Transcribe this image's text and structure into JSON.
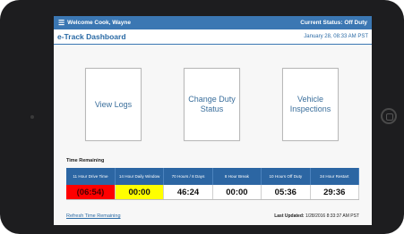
{
  "header": {
    "welcome": "Welcome Cook, Wayne",
    "status": "Current Status: Off Duty"
  },
  "titlebar": {
    "title": "e-Track Dashboard",
    "timestamp": "January 28, 08:33 AM PST"
  },
  "actions": {
    "view_logs": "View Logs",
    "change_duty_status": "Change Duty Status",
    "vehicle_inspections": "Vehicle Inspections"
  },
  "time_remaining": {
    "label": "Time Remaining",
    "columns": [
      {
        "label": "11 Hour Drive Time",
        "value": "(06:54)",
        "status_color": "#ff0000"
      },
      {
        "label": "14 Hour Daily Window",
        "value": "00:00",
        "status_color": "#ffff00"
      },
      {
        "label": "70 Hours / 8 Days",
        "value": "46:24",
        "status_color": "#ffffff"
      },
      {
        "label": "8 Hour Break",
        "value": "00:00",
        "status_color": "#ffffff"
      },
      {
        "label": "10 Hours Off Duty",
        "value": "05:36",
        "status_color": "#ffffff"
      },
      {
        "label": "34 Hour Restart",
        "value": "29:36",
        "status_color": "#ffffff"
      }
    ]
  },
  "footer": {
    "refresh_label": "Refresh Time Remaining",
    "last_updated_label": "Last Updated:",
    "last_updated_value": "1/28/2016 8:33:37 AM PST"
  },
  "colors": {
    "header_blue": "#3b77b3",
    "table_header_blue": "#2c66a3"
  },
  "icons": {
    "menu": "menu-icon"
  }
}
